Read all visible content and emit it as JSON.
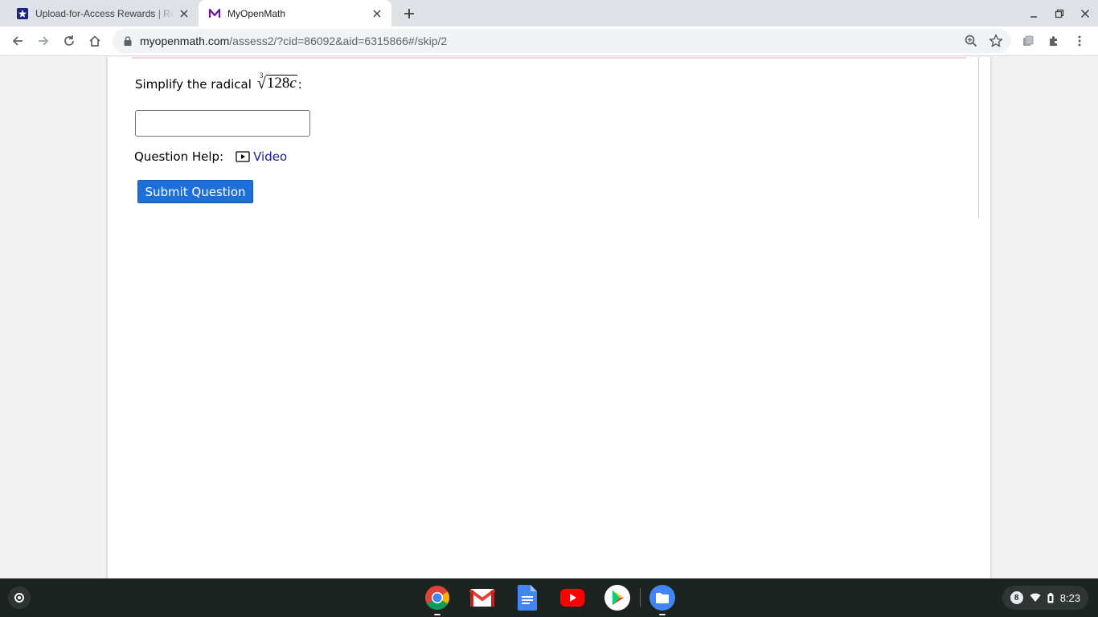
{
  "browser": {
    "tabs": [
      {
        "title": "Upload-for-Access Rewards | Rev",
        "active": false,
        "favicon": "star-shield-icon"
      },
      {
        "title": "MyOpenMath",
        "active": true,
        "favicon": "myopenmath-m-icon"
      }
    ],
    "address": {
      "domain": "myopenmath.com",
      "path": "/assess2/?cid=86092&aid=6315866#/skip/2"
    }
  },
  "question": {
    "prompt": "Simplify the radical",
    "radical_index": "3",
    "radicand_number": "128",
    "radicand_variable": "c",
    "suffix": ":",
    "answer_value": "",
    "help_label": "Question Help:",
    "video_label": "Video",
    "submit_label": "Submit Question"
  },
  "shelf": {
    "apps": [
      "chrome",
      "gmail",
      "docs",
      "youtube",
      "play-store",
      "files"
    ],
    "notification_count": "8",
    "time": "8:23"
  },
  "colors": {
    "accent_button": "#1e6fd9",
    "link": "#1a1aa6",
    "shelf": "#1c2320"
  }
}
